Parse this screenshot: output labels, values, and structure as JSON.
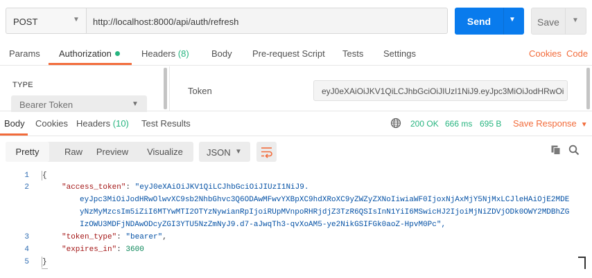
{
  "request": {
    "method": "POST",
    "url": "http://localhost:8000/api/auth/refresh",
    "send_label": "Send",
    "save_label": "Save"
  },
  "request_tabs": {
    "params": "Params",
    "authorization": "Authorization",
    "headers": "Headers",
    "headers_count": "(8)",
    "body": "Body",
    "prerequest": "Pre-request Script",
    "tests": "Tests",
    "settings": "Settings",
    "cookies": "Cookies",
    "code": "Code"
  },
  "auth": {
    "type_label": "TYPE",
    "type_value": "Bearer Token",
    "token_label": "Token",
    "token_value": "eyJ0eXAiOiJKV1QiLCJhbGciOiJIUzI1NiJ9.eyJpc3MiOiJodHRwOi..."
  },
  "response_tabs": {
    "body": "Body",
    "cookies": "Cookies",
    "headers": "Headers",
    "headers_count": "(10)",
    "test_results": "Test Results"
  },
  "response_status": {
    "status": "200 OK",
    "time": "666 ms",
    "size": "695 B",
    "save_response": "Save Response"
  },
  "view_modes": {
    "pretty": "Pretty",
    "raw": "Raw",
    "preview": "Preview",
    "visualize": "Visualize",
    "format": "JSON"
  },
  "code": {
    "line_numbers": [
      "1",
      "2",
      "3",
      "4",
      "5"
    ],
    "open_brace": "{",
    "close_brace": "}",
    "access_token_key": "\"access_token\"",
    "access_token_line1": "\"eyJ0eXAiOiJKV1QiLCJhbGciOiJIUzI1NiJ9.",
    "access_token_line2": "eyJpc3MiOiJodHRwOlwvXC9sb2NhbGhvc3Q6ODAwMFwvYXBpXC9hdXRoXC9yZWZyZXNoIiwiaWF0IjoxNjAxMjY5NjMxLCJleHAiOjE2MDEyNzMyMzcsIm5iZiI6MTYwMTI2OTYzNywianRpIjoiRUpMVnpoRHRjdjZ3TzR6QSIsInN1YiI6MSwicHJ2IjoiMjNiZDVjODk0OWY2MDBhZGIzOWU3MDFjNDAwODcyZGI3YTU5NzZmNyJ9.d7-aJwqTh3-qvXoAM5-ye2NikGSIFGk0aoZ-HpvM0Pc\",",
    "token_type_key": "\"token_type\"",
    "token_type_value": "\"bearer\"",
    "expires_in_key": "\"expires_in\"",
    "expires_in_value": "3600",
    "colon": ": ",
    "comma": ","
  },
  "colors": {
    "accent": "#f26b3a",
    "send": "#097bed",
    "success": "#26b47f"
  }
}
